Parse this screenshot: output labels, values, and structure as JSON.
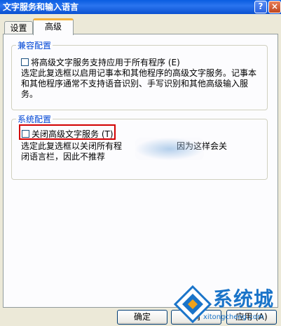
{
  "window": {
    "title": "文字服务和输入语言",
    "help_label": "?",
    "close_label": "×"
  },
  "tabs": [
    {
      "label": "设置",
      "selected": false
    },
    {
      "label": "高级",
      "selected": true
    }
  ],
  "compat": {
    "title": "兼容配置",
    "checkbox_label": "将高级文字服务支持应用于所有程序 (E)",
    "checked": false,
    "desc_line1": "选定此复选框以启用记事本和其他程序的高级文字服务。记事本",
    "desc_line2": "和其他程序通常不支持语音识别、手写识别和其他高级输入服",
    "desc_line3": "务。"
  },
  "system": {
    "title": "系统配置",
    "checkbox_label": "关闭高级文字服务 (T)",
    "checked": false,
    "desc_line1": "选定此复选框以关闭所有程",
    "desc_line1_end": "因为这样会关",
    "desc_line2": "闭语言栏，因此不推荐"
  },
  "buttons": {
    "ok": "确定",
    "cancel": "消",
    "apply": "应用 (A)"
  },
  "watermark": {
    "text": "系统城",
    "url": "xitongcheng.com"
  },
  "colors": {
    "accent": "#0046d5",
    "highlight_border": "#d20000",
    "title_bar": "#0a5de0"
  }
}
